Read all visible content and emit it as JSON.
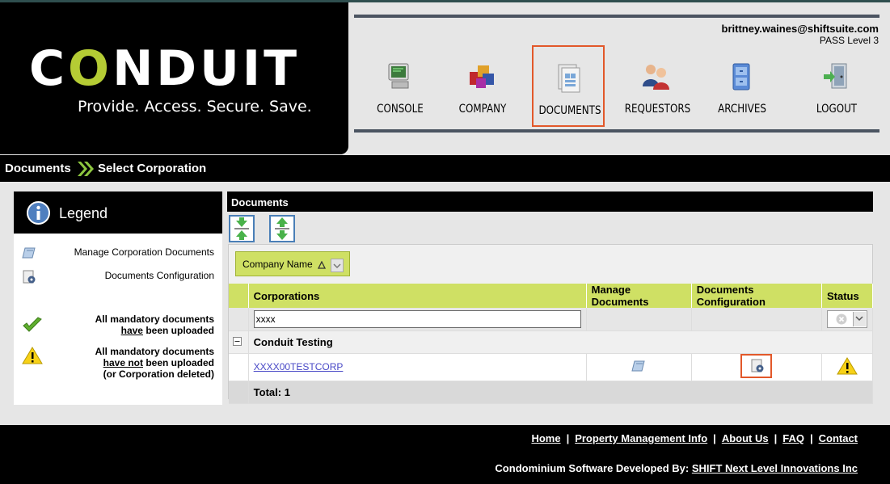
{
  "brand": {
    "logo_text": "CONDUIT",
    "tagline": "Provide. Access. Secure. Save.",
    "accent_color": "#b5cc34"
  },
  "user": {
    "email": "brittney.waines@shiftsuite.com",
    "level": "PASS Level 3"
  },
  "nav": {
    "items": [
      {
        "label": "CONSOLE",
        "icon": "monitor-icon"
      },
      {
        "label": "COMPANY",
        "icon": "company-cubes-icon"
      },
      {
        "label": "DOCUMENTS",
        "icon": "documents-icon",
        "active": true
      },
      {
        "label": "REQUESTORS",
        "icon": "people-icon"
      },
      {
        "label": "ARCHIVES",
        "icon": "archive-cabinet-icon"
      },
      {
        "label": "LOGOUT",
        "icon": "door-exit-icon"
      }
    ],
    "active_color": "#e2582a"
  },
  "breadcrumb": {
    "items": [
      "Documents",
      "Select Corporation"
    ]
  },
  "legend": {
    "title": "Legend",
    "items": [
      {
        "label": "Manage Corporation Documents",
        "icon": "manage-docs-icon"
      },
      {
        "label": "Documents Configuration",
        "icon": "doc-config-icon"
      },
      {
        "line1": "All mandatory documents",
        "line2a": "have",
        "line2b": " been uploaded",
        "icon": "green-check-icon"
      },
      {
        "line1": "All mandatory documents",
        "line2a": "have not",
        "line2b": " been uploaded",
        "line3": "(or Corporation deleted)",
        "icon": "warning-icon"
      }
    ]
  },
  "documents": {
    "panel_title": "Documents",
    "toolbar": {
      "expand": "expand-all-icon",
      "collapse": "collapse-all-icon"
    },
    "group_by": "Company Name",
    "columns": [
      "Corporations",
      "Manage Documents",
      "Documents Configuration",
      "Status"
    ],
    "filter_value": "xxxx",
    "group_label": "Conduit Testing",
    "rows": [
      {
        "corporation": "XXXX00TESTCORP"
      }
    ],
    "total": "Total: 1"
  },
  "footer": {
    "links": [
      "Home",
      "Property Management Info",
      "About Us",
      "FAQ",
      "Contact"
    ],
    "credit_prefix": "Condominium Software Developed By: ",
    "credit_link": "SHIFT Next Level Innovations Inc"
  }
}
